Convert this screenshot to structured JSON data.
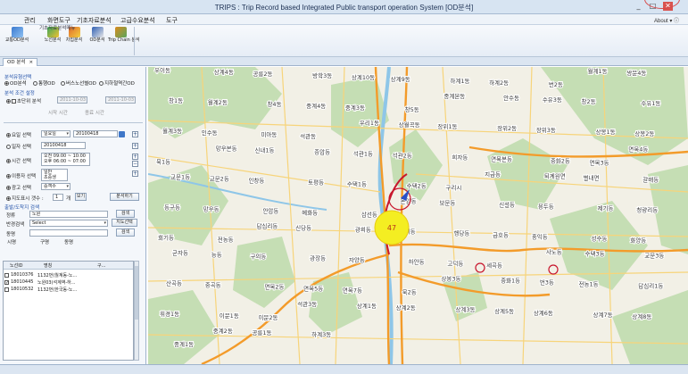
{
  "window": {
    "title": "TRIPS : Trip Record based Integrated Public transport operation System [OD분석]",
    "about": "About",
    "controls": [
      "_",
      "□",
      "✕"
    ]
  },
  "menu": [
    "관리",
    "화면도구",
    "기초자료분석",
    "고급수요분석",
    "도구"
  ],
  "ribbon": {
    "buttons": [
      {
        "label": "교통OD분석",
        "icon": "od-analysis-icon"
      },
      {
        "label": "노선분석",
        "icon": "route-analysis-icon"
      },
      {
        "label": "차집분석",
        "icon": "catchment-analysis-icon"
      },
      {
        "label": "OD분석",
        "icon": "od-icon"
      },
      {
        "label": "Trip Chain 분석",
        "icon": "trip-chain-icon"
      }
    ],
    "group_label": "기초자료분석메뉴"
  },
  "tab": {
    "label": "OD 분석",
    "close": "×"
  },
  "panel": {
    "analysis_type_title": "분석유형선택",
    "analysis_types": [
      "OD분석",
      "통행OD",
      "버스노선별OD",
      "지하철역간OD"
    ],
    "analysis_types_selected": 0,
    "condition_title": "분석 조건 설정",
    "multi_section_label": "초단위 분석",
    "start_date_placeholder": "2011-10-03",
    "end_date_placeholder": "2011-10-03",
    "start_time_placeholder": "시작 시간",
    "end_time_placeholder": "종료 시간",
    "day_label": "요일 선택",
    "day_value": "일요일",
    "day_date": "20100418",
    "date_label": "일자 선택",
    "date_value": "20100418",
    "time_label": "시간 선택",
    "time_sub_1": "오전",
    "time_range_1": "09:00 ~ 10:00",
    "time_sub_2": "오후",
    "time_range_2": "06:00 ~ 07:00",
    "mode_label": "이용자 선택",
    "mode_sub_1": "일반",
    "mode_sub_2": "초중생",
    "region_label": "광고 선택",
    "region_value": "승객수",
    "map_label": "지도표시 갯수 :",
    "map_count": "1",
    "map_unit": "개",
    "view_button": "보기",
    "run_button": "분석하기",
    "result_title": "출발/도착지 검색",
    "result_section_label": "정류",
    "result_section_value": "노원",
    "search_button": "검색",
    "stop_search_label": "반경검색",
    "stop_search_value": "Select",
    "stop_search_button": "지도선택",
    "city_label": "동명",
    "city_search_button": "검색",
    "list_headers": [
      "시명",
      "구명",
      "동명"
    ],
    "route_headers": [
      "노선ID",
      "명칭",
      "구..."
    ],
    "routes": [
      {
        "id": "18010376",
        "name": "1132번(월계동-노...",
        "checked": false
      },
      {
        "id": "18010445",
        "name": "노원03(석계역-하...",
        "checked": true
      },
      {
        "id": "18010532",
        "name": "1132번(한국동-노...",
        "checked": false
      }
    ]
  },
  "map": {
    "od_value": "47",
    "labels": [
      "우이동",
      "상계4동",
      "공릉2동",
      "방학3동",
      "상계10동",
      "상계9동",
      "하계1동",
      "하계2동",
      "번2동",
      "월계1동",
      "쌍문4동",
      "창1동",
      "월계2동",
      "창4동",
      "중계4동",
      "중계3동",
      "창5동",
      "중계본동",
      "안수동",
      "수유3동",
      "창2동",
      "수유1동",
      "월계3동",
      "인수동",
      "미아동",
      "석관동",
      "우리1동",
      "상월곡동",
      "장위1동",
      "장위2동",
      "장위3동",
      "상봉1동",
      "상봉2동",
      "묵1동",
      "망우본동",
      "신내1동",
      "종암동",
      "석관1동",
      "석관2동",
      "희자동",
      "면목본동",
      "중화2동",
      "면목3동",
      "면목4동",
      "교문1동",
      "교문2동",
      "인창동",
      "토평동",
      "수택1동",
      "수택2동",
      "구리시",
      "지금동",
      "퇴계원면",
      "별내면",
      "갈매동",
      "동구동",
      "망우동",
      "안암동",
      "혜화동",
      "삼선동",
      "돈암동",
      "보문동",
      "신설동",
      "용두동",
      "제기동",
      "청량리동",
      "회기동",
      "전농동",
      "답십리동",
      "신당동",
      "광희동",
      "왕십리동",
      "행당동",
      "금호동",
      "홍익동",
      "성수동",
      "화양동",
      "군자동",
      "능동",
      "구의동",
      "광장동",
      "자양동",
      "하안동",
      "고덕동",
      "세곡동",
      "사노동",
      "수택3동",
      "교문3동",
      "산곡동",
      "중곡동",
      "면목2동",
      "면목5동",
      "면목7동",
      "묵2동",
      "상봉3동",
      "중화1동",
      "번3동",
      "전농1동",
      "답십리1동",
      "휘경1동",
      "이문1동",
      "이문2동",
      "석관3동",
      "상계1동",
      "상계2동",
      "상계3동",
      "상계5동",
      "상계6동",
      "상계7동",
      "상계8동",
      "중계1동",
      "중계2동",
      "공릉1동",
      "하계3동"
    ]
  },
  "colors": {
    "od_marker": "#f4ee22",
    "route_line": "#c8162d",
    "road_main": "#f39b2a",
    "road_minor": "#f7d47a",
    "water": "#8ec6e8",
    "park": "#b9d9a8"
  }
}
